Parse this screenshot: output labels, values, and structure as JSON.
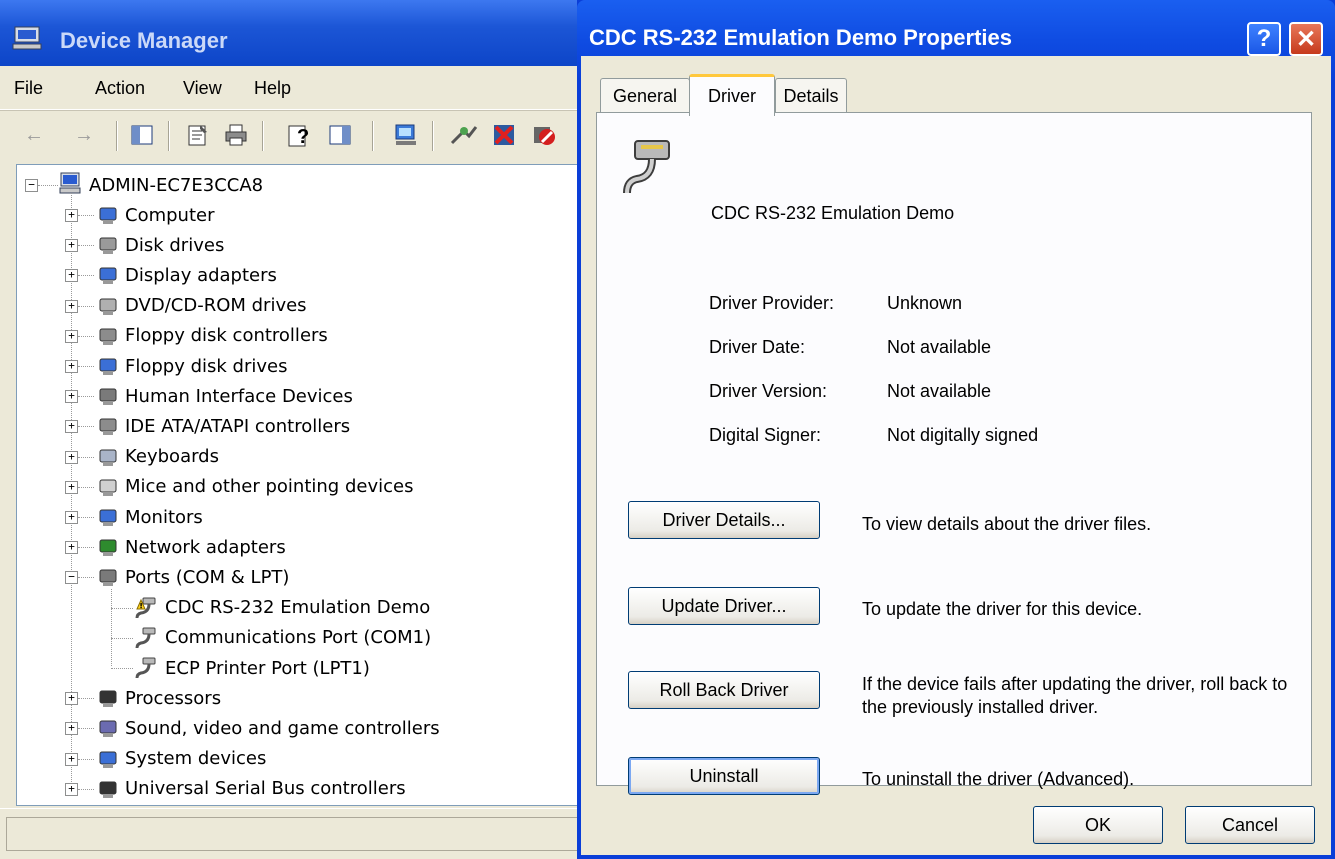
{
  "device_manager": {
    "title": "Device Manager",
    "menu": [
      "File",
      "Action",
      "View",
      "Help"
    ],
    "root": "ADMIN-EC7E3CCA8",
    "categories": [
      {
        "label": "Computer",
        "icon": "computer-icon"
      },
      {
        "label": "Disk drives",
        "icon": "disk-drive-icon"
      },
      {
        "label": "Display adapters",
        "icon": "display-adapter-icon"
      },
      {
        "label": "DVD/CD-ROM drives",
        "icon": "dvd-drive-icon"
      },
      {
        "label": "Floppy disk controllers",
        "icon": "floppy-controller-icon"
      },
      {
        "label": "Floppy disk drives",
        "icon": "floppy-drive-icon"
      },
      {
        "label": "Human Interface Devices",
        "icon": "hid-icon"
      },
      {
        "label": "IDE ATA/ATAPI controllers",
        "icon": "ide-controller-icon"
      },
      {
        "label": "Keyboards",
        "icon": "keyboard-icon"
      },
      {
        "label": "Mice and other pointing devices",
        "icon": "mouse-icon"
      },
      {
        "label": "Monitors",
        "icon": "monitor-icon"
      },
      {
        "label": "Network adapters",
        "icon": "network-adapter-icon"
      },
      {
        "label": "Ports (COM & LPT)",
        "icon": "port-icon",
        "expanded": true
      },
      {
        "label": "Processors",
        "icon": "processor-icon"
      },
      {
        "label": "Sound, video and game controllers",
        "icon": "sound-icon"
      },
      {
        "label": "System devices",
        "icon": "system-device-icon"
      },
      {
        "label": "Universal Serial Bus controllers",
        "icon": "usb-icon"
      }
    ],
    "ports_children": [
      {
        "label": "CDC RS-232 Emulation Demo",
        "warning": true
      },
      {
        "label": "Communications Port (COM1)"
      },
      {
        "label": "ECP Printer Port (LPT1)"
      }
    ],
    "status": ""
  },
  "properties": {
    "title": "CDC RS-232 Emulation Demo Properties",
    "help_glyph": "?",
    "close_glyph": "✕",
    "tabs": [
      "General",
      "Driver",
      "Details"
    ],
    "active_tab": "Driver",
    "device_name": "CDC RS-232 Emulation Demo",
    "fields": [
      {
        "label": "Driver Provider:",
        "value": "Unknown"
      },
      {
        "label": "Driver Date:",
        "value": "Not available"
      },
      {
        "label": "Driver Version:",
        "value": "Not available"
      },
      {
        "label": "Digital Signer:",
        "value": "Not digitally signed"
      }
    ],
    "actions": [
      {
        "button": "Driver Details...",
        "description": "To view details about the driver files."
      },
      {
        "button": "Update Driver...",
        "description": "To update the driver for this device."
      },
      {
        "button": "Roll Back Driver",
        "description": "If the device fails after updating the driver, roll back to the previously installed driver."
      },
      {
        "button": "Uninstall",
        "description": "To uninstall the driver (Advanced)."
      }
    ],
    "ok_label": "OK",
    "cancel_label": "Cancel"
  },
  "colors": {
    "xp_blue": "#0a3ed8",
    "dialog_face": "#ece9d8",
    "tab_highlight": "#ffc83c",
    "close_red": "#c63a1c"
  }
}
